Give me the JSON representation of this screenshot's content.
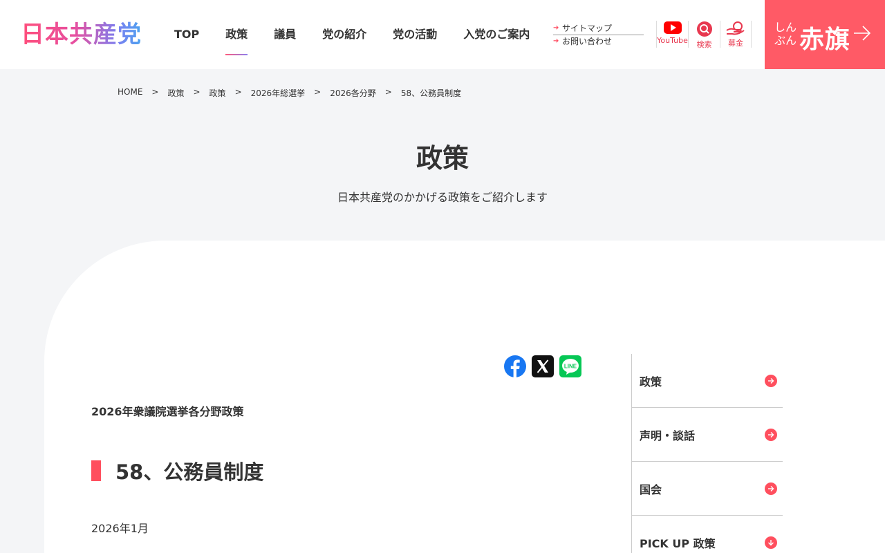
{
  "header": {
    "logo": "日本共産党",
    "nav": [
      "TOP",
      "政策",
      "議員",
      "党の紹介",
      "党の活動",
      "入党のご案内"
    ],
    "active_nav": "政策",
    "sublinks": [
      "サイトマップ",
      "お問い合わせ"
    ],
    "icon_links": [
      {
        "label": "YouTube",
        "icon": "youtube-icon"
      },
      {
        "label": "検索",
        "icon": "search-icon"
      },
      {
        "label": "募金",
        "icon": "donation-icon"
      }
    ],
    "akahata": {
      "small_line1": "しん",
      "small_line2": "ぶん",
      "big": "赤旗"
    }
  },
  "breadcrumb": [
    "HOME",
    "政策",
    "政策",
    "2026年総選挙",
    "2026各分野",
    "58、公務員制度"
  ],
  "breadcrumb_sep": ">",
  "page": {
    "title": "政策",
    "subtitle": "日本共産党のかかげる政策をご紹介します"
  },
  "share": [
    {
      "name": "facebook",
      "color": "#1877f2"
    },
    {
      "name": "x",
      "color": "#111111"
    },
    {
      "name": "line",
      "color": "#06c755"
    }
  ],
  "article": {
    "kicker": "2026年衆議院選挙各分野政策",
    "title": "58、公務員制度",
    "date": "2026年1月"
  },
  "side_menu": [
    {
      "label": "政策",
      "icon": "arrow-right"
    },
    {
      "label": "声明・談話",
      "icon": "arrow-right"
    },
    {
      "label": "国会",
      "icon": "arrow-right"
    },
    {
      "label": "PICK UP 政策",
      "icon": "arrow-down"
    }
  ],
  "colors": {
    "accent": "#ff4f5e",
    "akahata_bg": "#ff5a66",
    "page_bg": "#f4f5f7"
  }
}
